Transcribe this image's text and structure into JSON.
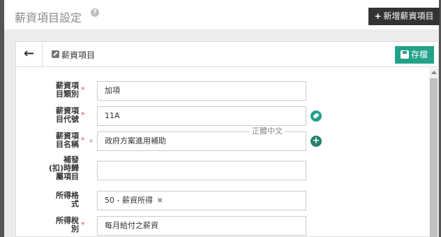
{
  "header": {
    "title": "薪資項目設定",
    "help_glyph": "?",
    "add_button_icon": "+",
    "add_button_label": "新增薪資項目"
  },
  "card": {
    "back_glyph": "←",
    "title": "薪資項目",
    "save_label": "存檔"
  },
  "form": {
    "required_mark": "*",
    "fields": [
      {
        "label_line1": "薪資項",
        "label_line2": "目類別",
        "value": "加項"
      },
      {
        "label_line1": "薪資項",
        "label_line2": "目代號",
        "value": "11A"
      },
      {
        "label_line1": "薪資項",
        "label_line2": "目名稱",
        "value": "政府方案進用補助",
        "legend": "正體中文",
        "add_glyph": "+"
      },
      {
        "label_line1": "補發",
        "label_line2": "(扣)時歸",
        "label_line3": "屬項目",
        "value": ""
      },
      {
        "label_line1": "所得格",
        "label_line2": "式",
        "value": "50 - 薪資所得",
        "clear_glyph": "✖"
      },
      {
        "label_line1": "所得稅",
        "label_line2": "別",
        "value": "每月給付之薪資"
      }
    ]
  },
  "colors": {
    "accent": "#23a28a",
    "header_button": "#333333",
    "required": "#d9534f"
  }
}
